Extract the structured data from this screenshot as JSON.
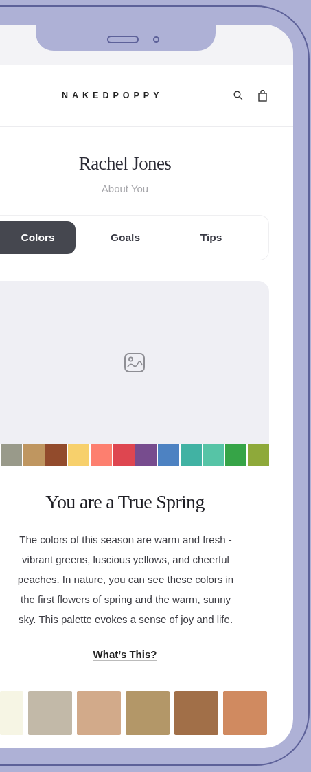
{
  "header": {
    "logo": "NAKEDPOPPY"
  },
  "profile": {
    "name": "Rachel Jones",
    "subtitle": "About You"
  },
  "tabs": [
    {
      "label": "Colors",
      "selected": true
    },
    {
      "label": "Goals",
      "selected": false
    },
    {
      "label": "Tips",
      "selected": false
    }
  ],
  "palette": [
    {
      "color": "#999a8a"
    },
    {
      "color": "#bf9660"
    },
    {
      "color": "#924b2c"
    },
    {
      "color": "#f7d06c"
    },
    {
      "color": "#fd7f6f"
    },
    {
      "color": "#de4650"
    },
    {
      "color": "#774c8e"
    },
    {
      "color": "#4d82c2"
    },
    {
      "color": "#41b2a3"
    },
    {
      "color": "#56c4a6"
    },
    {
      "color": "#36a447"
    },
    {
      "color": "#8ea93a"
    }
  ],
  "season": {
    "title": "You are a True Spring",
    "lines": [
      "The colors of this season are warm and fresh -",
      "vibrant greens, luscious yellows, and cheerful",
      "peaches. In nature, you can see these colors in",
      "the first flowers of spring and the warm, sunny",
      "sky. This palette evokes a sense of joy and life."
    ],
    "link": "What’s This?"
  },
  "swatches": [
    {
      "color": "#f6f5e4"
    },
    {
      "color": "#c2b9a8"
    },
    {
      "color": "#d2aa8a"
    },
    {
      "color": "#b39768"
    },
    {
      "color": "#a16f48"
    },
    {
      "color": "#d08a60"
    }
  ]
}
